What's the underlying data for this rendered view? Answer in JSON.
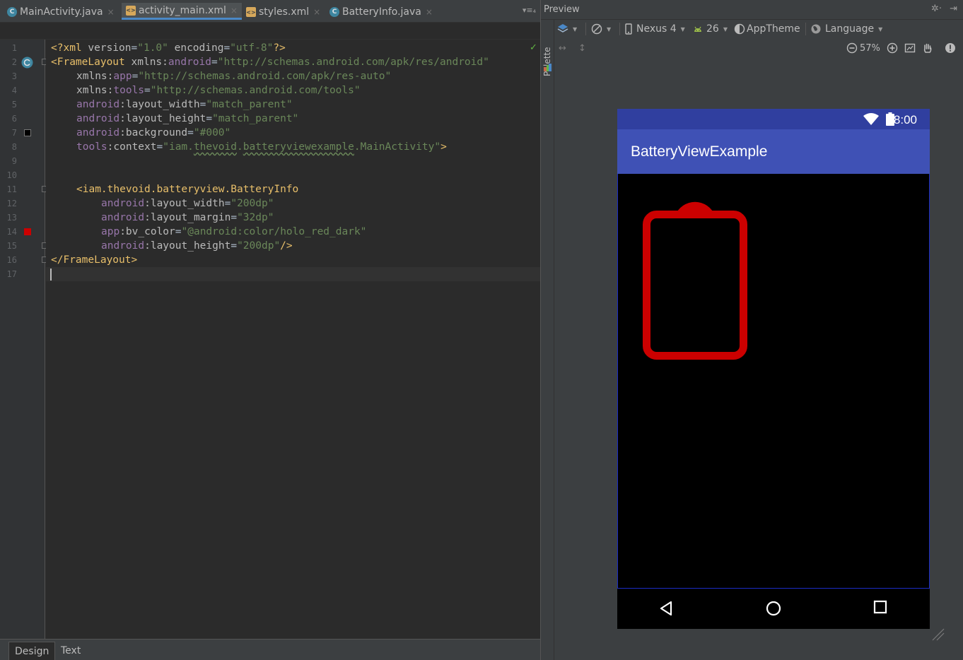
{
  "editor": {
    "tabs": [
      {
        "label": "MainActivity.java",
        "icon": "class-file-icon",
        "active": false
      },
      {
        "label": "activity_main.xml",
        "icon": "xml-file-icon",
        "active": true
      },
      {
        "label": "styles.xml",
        "icon": "xml-file-icon",
        "active": false
      },
      {
        "label": "BatteryInfo.java",
        "icon": "class-file-icon",
        "active": false
      }
    ],
    "tab_overflow": "▾≡₄",
    "line_numbers": [
      "1",
      "2",
      "3",
      "4",
      "5",
      "6",
      "7",
      "8",
      "9",
      "10",
      "11",
      "12",
      "13",
      "14",
      "15",
      "16",
      "17"
    ],
    "code": {
      "l1": {
        "open": "<?xml ",
        "a1": "version",
        "eq1": "=",
        "s1": "\"1.0\"",
        "a2": " encoding",
        "eq2": "=",
        "s2": "\"utf-8\"",
        "close": "?>"
      },
      "l2": {
        "tag": "<FrameLayout ",
        "attr": "xmlns:",
        "ns": "android",
        "eq": "=",
        "str": "\"http://schemas.android.com/apk/res/android\""
      },
      "l3": {
        "attr": "xmlns:",
        "ns": "app",
        "eq": "=",
        "str": "\"http://schemas.android.com/apk/res-auto\""
      },
      "l4": {
        "attr": "xmlns:",
        "ns": "tools",
        "eq": "=",
        "str": "\"http://schemas.android.com/tools\""
      },
      "l5": {
        "ns": "android",
        "attr": ":layout_width",
        "eq": "=",
        "str": "\"match_parent\""
      },
      "l6": {
        "ns": "android",
        "attr": ":layout_height",
        "eq": "=",
        "str": "\"match_parent\""
      },
      "l7": {
        "ns": "android",
        "attr": ":background",
        "eq": "=",
        "str": "\"#000\""
      },
      "l8": {
        "ns": "tools",
        "attr": ":context",
        "eq": "=",
        "str_a": "\"iam.",
        "str_b": "thevoid",
        "str_c": ".",
        "str_d": "batteryviewexample",
        "str_e": ".MainActivity\"",
        "close": ">"
      },
      "l11": {
        "tag": "<iam.thevoid.batteryview.BatteryInfo"
      },
      "l12": {
        "ns": "android",
        "attr": ":layout_width",
        "eq": "=",
        "str": "\"200dp\""
      },
      "l13": {
        "ns": "android",
        "attr": ":layout_margin",
        "eq": "=",
        "str": "\"32dp\""
      },
      "l14": {
        "ns": "app",
        "attr": ":bv_color",
        "eq": "=",
        "str": "\"@android:color/holo_red_dark\""
      },
      "l15": {
        "ns": "android",
        "attr": ":layout_height",
        "eq": "=",
        "str": "\"200dp\"",
        "close": "/>"
      },
      "l16": {
        "tag": "</FrameLayout>"
      }
    },
    "gutter_colors": {
      "line7": "#000000",
      "line14": "#cc0000"
    },
    "bottom_tabs": [
      {
        "label": "Design",
        "active": true
      },
      {
        "label": "Text",
        "active": false
      }
    ]
  },
  "preview": {
    "title": "Preview",
    "settings_glyph": "✲·",
    "hide_glyph": "⇥",
    "palette_label": "Palette",
    "toolbar": {
      "device": "Nexus 4",
      "api": "26",
      "theme": "AppTheme",
      "language": "Language",
      "zoom": "57%"
    },
    "device": {
      "time": "8:00",
      "app_title": "BatteryViewExample",
      "status_bar_color": "#303f9f",
      "app_bar_color": "#3f51b5",
      "battery_color": "#cc0000",
      "background": "#000000"
    }
  }
}
